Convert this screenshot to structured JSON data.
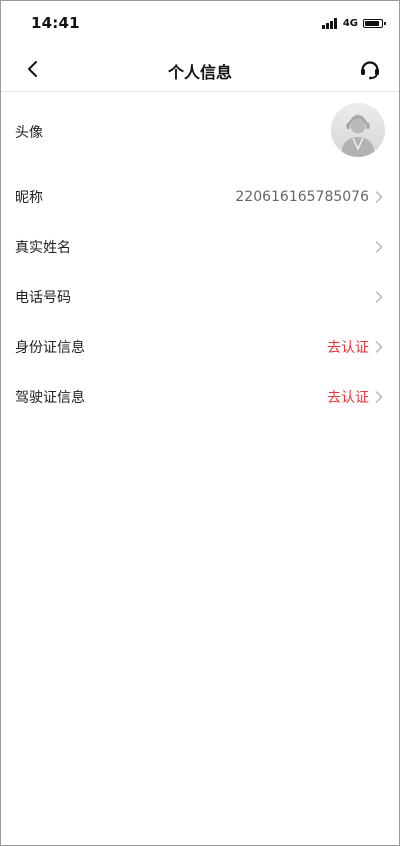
{
  "status_bar": {
    "time": "14:41",
    "network": "4G",
    "battery_level": 0.85
  },
  "nav": {
    "title": "个人信息",
    "back_icon": "chevron-left-icon",
    "service_icon": "customer-service-icon"
  },
  "rows": [
    {
      "label": "头像",
      "value": "",
      "type": "avatar"
    },
    {
      "label": "昵称",
      "value": "220616165785076",
      "type": "text"
    },
    {
      "label": "真实姓名",
      "value": "",
      "type": "text"
    },
    {
      "label": "电话号码",
      "value": "",
      "type": "text"
    },
    {
      "label": "身份证信息",
      "value": "去认证",
      "type": "action"
    },
    {
      "label": "驾驶证信息",
      "value": "去认证",
      "type": "action"
    }
  ],
  "colors": {
    "accent_red": "#e8373d",
    "value_gray": "#666666",
    "chevron_gray": "#b5b5b5",
    "divider": "#e4e4e4"
  }
}
